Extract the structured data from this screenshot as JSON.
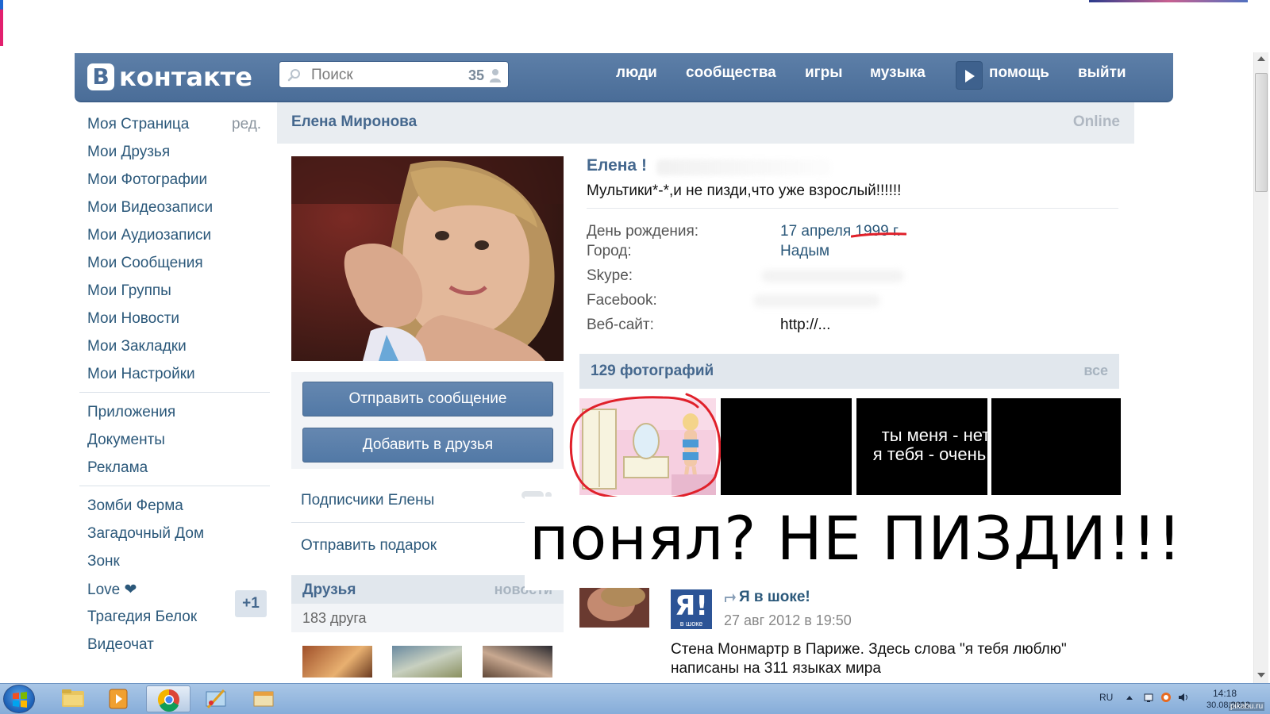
{
  "header": {
    "logo_letter": "В",
    "logo_text": "контакте",
    "search_placeholder": "Поиск",
    "search_count": "35",
    "nav": [
      "люди",
      "сообщества",
      "игры",
      "музыка",
      "помощь",
      "выйти"
    ]
  },
  "left_menu": {
    "edit_label": "ред.",
    "group1": [
      "Моя Страница",
      "Мои Друзья",
      "Мои Фотографии",
      "Мои Видеозаписи",
      "Мои Аудиозаписи",
      "Мои Сообщения",
      "Мои Группы",
      "Мои Новости",
      "Мои Закладки",
      "Мои Настройки"
    ],
    "group2": [
      "Приложения",
      "Документы",
      "Реклама"
    ],
    "group3": [
      "Зомби Ферма",
      "Загадочный Дом",
      "Зонк",
      "Love ❤",
      "Трагедия Белок",
      "Видеочат"
    ],
    "love_badge": "+1"
  },
  "profile": {
    "header_name": "Елена Миронова",
    "online": "Online",
    "name_visible": "Елена !",
    "status": "Мультики*-*,и не пизди,что уже взрослый!!!!!!",
    "fields": [
      {
        "label": "День рождения:",
        "value": "17 апреля 1999 г."
      },
      {
        "label": "Город:",
        "value": "Надым"
      },
      {
        "label": "Skype:",
        "value": ""
      },
      {
        "label": "Facebook:",
        "value": ""
      },
      {
        "label": "Веб-сайт:",
        "value": "http://..."
      }
    ]
  },
  "actions": {
    "send_message": "Отправить сообщение",
    "add_friend": "Добавить в друзья",
    "subscribers": "Подписчики Елены",
    "send_gift": "Отправить подарок"
  },
  "friends": {
    "title": "Друзья",
    "news": "новости",
    "count": "183 друга"
  },
  "photos": {
    "title": "129 фотографий",
    "all": "все",
    "photo3_text": [
      "ты меня - нет",
      "я тебя - очень"
    ]
  },
  "meme_caption": "понял? НЕ ПИЗДИ!!!",
  "post": {
    "logo_letter": "Я!",
    "logo_sub": "в шоке",
    "author": "Я в шоке!",
    "date": "27 авг 2012 в 19:50",
    "text": "Стена Монмартр в Париже. Здесь слова \"я тебя люблю\" написаны на 311 языках мира"
  },
  "taskbar": {
    "lang": "RU",
    "time": "14:18",
    "date": "30.08.2012"
  },
  "watermark": "pikabu.ru",
  "colors": {
    "header_blue": "#4a6d98",
    "link_blue": "#2b587a",
    "title_blue": "#45688e",
    "annotation_red": "#e0202a"
  }
}
